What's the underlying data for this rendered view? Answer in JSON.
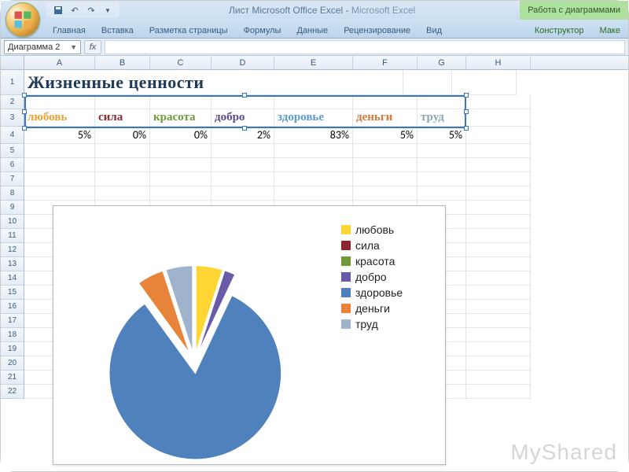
{
  "window": {
    "doc_title": "Лист Microsoft Office Excel",
    "app_name": "Microsoft Excel",
    "chart_tools_label": "Работа с диаграммами"
  },
  "ribbon": {
    "tabs": [
      "Главная",
      "Вставка",
      "Разметка страницы",
      "Формулы",
      "Данные",
      "Рецензирование",
      "Вид"
    ],
    "context_tabs": [
      "Конструктор",
      "Маке"
    ]
  },
  "namebox": {
    "value": "Диаграмма 2"
  },
  "columns": [
    "A",
    "B",
    "C",
    "D",
    "E",
    "F",
    "G",
    "H"
  ],
  "cells": {
    "title": "Жизненные ценности",
    "headers": [
      {
        "label": "любовь",
        "color": "#e6a23a"
      },
      {
        "label": "сила",
        "color": "#8a2a2e"
      },
      {
        "label": "красота",
        "color": "#6f9a3a"
      },
      {
        "label": "добро",
        "color": "#5a4a8a"
      },
      {
        "label": "здоровье",
        "color": "#5b9bd5"
      },
      {
        "label": "деньги",
        "color": "#d47a3a"
      },
      {
        "label": "труд",
        "color": "#8aa4b8"
      }
    ],
    "values": [
      "5%",
      "0%",
      "0%",
      "2%",
      "83%",
      "5%",
      "5%"
    ]
  },
  "chart_data": {
    "type": "pie",
    "title": "",
    "categories": [
      "любовь",
      "сила",
      "красота",
      "добро",
      "здоровье",
      "деньги",
      "труд"
    ],
    "values": [
      5,
      0,
      0,
      2,
      83,
      5,
      5
    ],
    "colors": [
      "#ffd633",
      "#8a2a2e",
      "#6f9a3a",
      "#6a5aa8",
      "#4f81bd",
      "#e8843a",
      "#9fb4cc"
    ]
  },
  "watermark": "MyShared"
}
